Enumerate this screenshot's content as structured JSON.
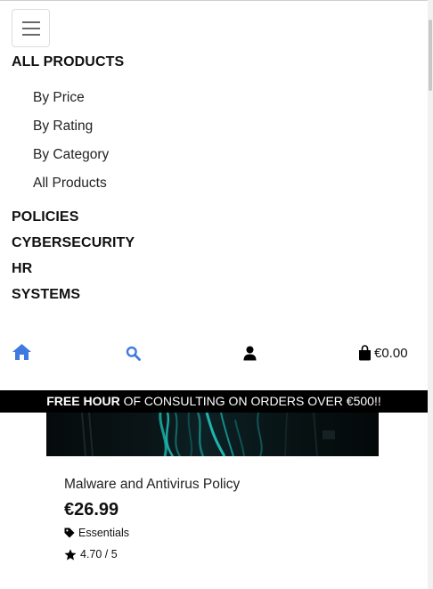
{
  "nav": {
    "menu_heading": "ALL PRODUCTS",
    "submenu": [
      "By Price",
      "By Rating",
      "By Category",
      "All Products"
    ],
    "categories": [
      "POLICIES",
      "CYBERSECURITY",
      "HR",
      "SYSTEMS"
    ]
  },
  "iconbar": {
    "home_icon": "home-icon",
    "search_icon": "search-icon",
    "account_icon": "user-icon",
    "cart_icon": "shopping-bag-icon",
    "cart_total": "€0.00",
    "accent_color": "#3f7ae0"
  },
  "banner": {
    "bold": "FREE HOUR",
    "text": " OF CONSULTING ON ORDERS OVER €500!!"
  },
  "product": {
    "name": "Malware and Antivirus Policy",
    "price": "€26.99",
    "category": "Essentials",
    "rating": "4.70 / 5"
  }
}
